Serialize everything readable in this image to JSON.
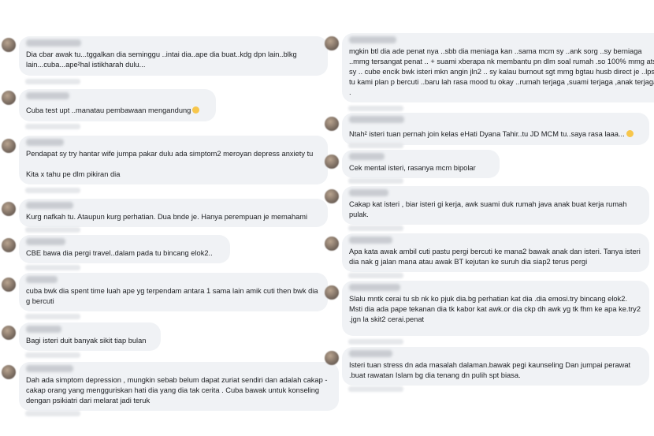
{
  "left_comments": [
    {
      "text": "Dia cbar awak tu...tggalkan dia seminggu ..intai dia..ape dia buat..kdg dpn lain..blkg lain...cuba...ape²hal istikharah dulu..."
    },
    {
      "text": "Cuba test upt ..manatau pembawaan mengandung",
      "emoji": "grin-emoji"
    },
    {
      "text": "Pendapat sy try hantar wife jumpa pakar dulu ada simptom2 meroyan depress anxiety tu\n\nKita x tahu pe dlm pikiran dia"
    },
    {
      "text": "Kurg nafkah tu. Ataupun kurg perhatian. Dua bnde je. Hanya perempuan je memahami"
    },
    {
      "text": "CBE bawa dia pergi travel..dalam pada tu bincang elok2.."
    },
    {
      "text": "cuba bwk dia spent time luah ape yg terpendam antara 1 sama lain amik cuti then bwk dia g bercuti"
    },
    {
      "text": "Bagi isteri duit banyak sikit tiap bulan"
    },
    {
      "text": "Dah ada simptom depression , mungkin sebab belum dapat zuriat sendiri dan adalah cakap - cakap orang yang mengguriskan hati dia yang dia tak cerita . Cuba bawak untuk konseling dengan psikiatri dari melarat jadi teruk"
    }
  ],
  "right_comments": [
    {
      "text": "mgkin btl dia ade penat nya ..sbb dia meniaga kan ..sama mcm sy ..ank sorg ..sy berniaga ..mmg tersangat penat .. + suami xberapa nk membantu pn dlm soal rumah .so 100% mmg ats sy .. cube encik bwk isteri mkn angin jln2 .. sy kalau burnout sgt mmg bgtau husb direct je ..lps tu kami plan p bercuti ..baru lah rasa mood tu okay ..rumah terjaga ,suami terjaga ,anak terjaga ."
    },
    {
      "text": "Ntah² isteri tuan pernah join kelas eHati Dyana Tahir..tu JD MCM tu..saya rasa laaa...",
      "emoji": "grin-emoji"
    },
    {
      "text": "Cek mental isteri, rasanya mcm bipolar"
    },
    {
      "text": "Cakap kat isteri , biar isteri gi kerja, awk suami duk rumah java anak buat kerja rumah pulak."
    },
    {
      "text": "Apa kata awak ambil cuti pastu pergi bercuti ke mana2 bawak anak dan isteri. Tanya isteri dia nak g jalan mana atau awak BT kejutan ke suruh dia siap2 terus pergi"
    },
    {
      "text": "Slalu mntk cerai tu sb nk ko pjuk dia.bg perhatian kat dia .dia emosi.try bincang elok2. Msti dia ada pape tekanan dia tk kabor kat awk.or dia ckp dh awk yg tk fhm ke apa ke.try2 .jgn la skit2 cerai.penat"
    },
    {
      "text": "Isteri tuan stress dn ada masalah dalaman.bawak pegi kaunseling Dan jumpai perawat .buat rawatan Islam bg dia tenang dn pulih spt biasa."
    }
  ]
}
